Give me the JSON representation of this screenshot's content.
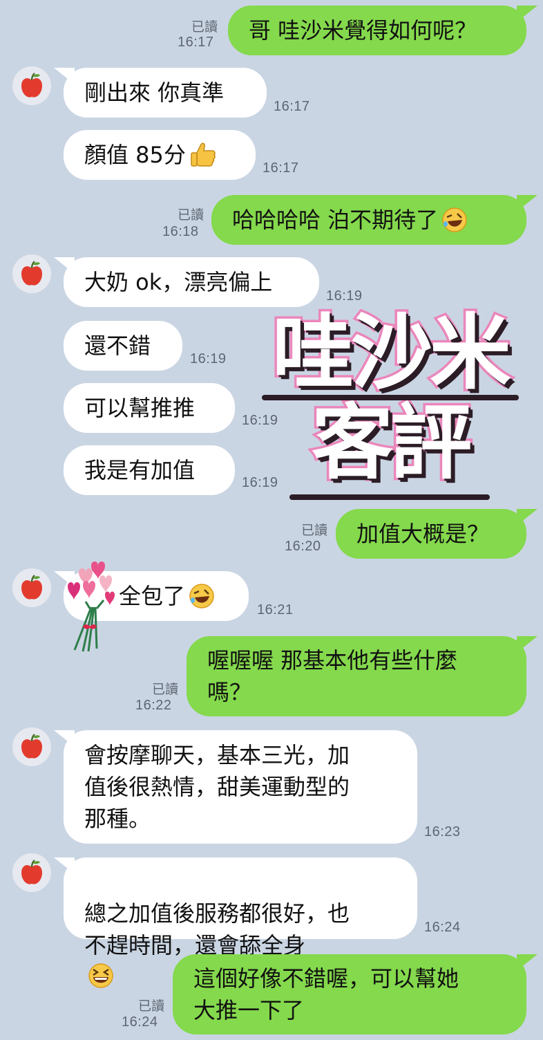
{
  "chat": {
    "read_label": "已讀",
    "messages": [
      {
        "side": "out",
        "text": "哥 哇沙米覺得如何呢？",
        "time": "16:17",
        "read": true
      },
      {
        "side": "in",
        "text": "剛出來 你真準",
        "time": "16:17"
      },
      {
        "side": "in",
        "text": "顏值 85分",
        "time": "16:17",
        "emoji": "thumbs-up"
      },
      {
        "side": "out",
        "text": "哈哈哈哈 泊不期待了",
        "time": "16:18",
        "read": true,
        "emoji": "rofl"
      },
      {
        "side": "in",
        "text": "大奶 ok，漂亮偏上",
        "time": "16:19"
      },
      {
        "side": "in",
        "text": "還不錯",
        "time": "16:19"
      },
      {
        "side": "in",
        "text": "可以幫推推",
        "time": "16:19"
      },
      {
        "side": "in",
        "text": "我是有加值",
        "time": "16:19"
      },
      {
        "side": "out",
        "text": "加值大概是？",
        "time": "16:20",
        "read": true
      },
      {
        "side": "in",
        "text": "全包了",
        "time": "16:21",
        "emoji": "rofl"
      },
      {
        "side": "out",
        "text": "喔喔喔  那基本他有些什麼\n嗎？",
        "time": "16:22",
        "read": true
      },
      {
        "side": "in",
        "text": "會按摩聊天，基本三光，加\n值後很熱情，甜美運動型的\n那種。",
        "time": "16:23"
      },
      {
        "side": "in",
        "text": "總之加值後服務都很好，也\n不趕時間，還會舔全身",
        "time": "16:24",
        "emoji": "grin"
      },
      {
        "side": "out",
        "text": "這個好像不錯喔，可以幫她\n大推一下了",
        "time": "16:24",
        "read": true
      }
    ]
  },
  "overlay": {
    "line1": "哇沙米",
    "line2": "客評",
    "text_color": "#ffffff",
    "outline_color": "#ea86bb"
  },
  "icons": {
    "avatar": "apple-icon",
    "bouquet": "flower-bouquet-icon"
  },
  "colors": {
    "background": "#cad5e3",
    "incoming_bubble": "#ffffff",
    "outgoing_bubble": "#84d94c",
    "meta_text": "#5d6672"
  }
}
